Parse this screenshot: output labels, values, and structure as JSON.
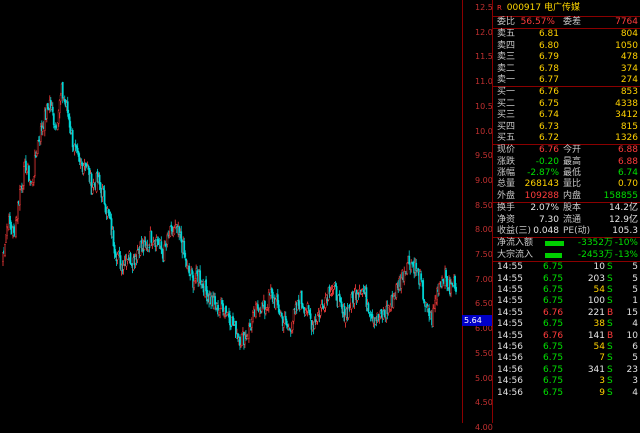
{
  "header": {
    "flag": "R",
    "code": "000917",
    "name": "电广传媒"
  },
  "axis": {
    "ticks": [
      "12.50",
      "12.00",
      "11.50",
      "11.00",
      "10.50",
      "10.00",
      "9.50",
      "9.00",
      "8.50",
      "8.00",
      "7.50",
      "7.00",
      "6.50",
      "6.00",
      "5.50",
      "5.00",
      "4.50",
      "4.00"
    ],
    "current": "5.64"
  },
  "order_book": {
    "ratio_label": "委比",
    "ratio": "56.57%",
    "diff_label": "委差",
    "diff": "7764",
    "asks": [
      {
        "label": "卖五",
        "price": "6.81",
        "vol": "804"
      },
      {
        "label": "卖四",
        "price": "6.80",
        "vol": "1050"
      },
      {
        "label": "卖三",
        "price": "6.79",
        "vol": "478"
      },
      {
        "label": "卖二",
        "price": "6.78",
        "vol": "374"
      },
      {
        "label": "卖一",
        "price": "6.77",
        "vol": "274"
      }
    ],
    "bids": [
      {
        "label": "买一",
        "price": "6.76",
        "vol": "853"
      },
      {
        "label": "买二",
        "price": "6.75",
        "vol": "4338"
      },
      {
        "label": "买三",
        "price": "6.74",
        "vol": "3412"
      },
      {
        "label": "买四",
        "price": "6.73",
        "vol": "815"
      },
      {
        "label": "买五",
        "price": "6.72",
        "vol": "1326"
      }
    ]
  },
  "quote": [
    {
      "l1": "现价",
      "v1": "6.76",
      "c1": "red",
      "l2": "今开",
      "v2": "6.88",
      "c2": "red"
    },
    {
      "l1": "涨跌",
      "v1": "-0.20",
      "c1": "grn",
      "l2": "最高",
      "v2": "6.88",
      "c2": "red"
    },
    {
      "l1": "涨幅",
      "v1": "-2.87%",
      "c1": "grn",
      "l2": "最低",
      "v2": "6.74",
      "c2": "grn"
    },
    {
      "l1": "总量",
      "v1": "268143",
      "c1": "yel",
      "l2": "量比",
      "v2": "0.70",
      "c2": "yel"
    },
    {
      "l1": "外盘",
      "v1": "109288",
      "c1": "red",
      "l2": "内盘",
      "v2": "158855",
      "c2": "grn"
    }
  ],
  "stats": [
    {
      "l1": "换手",
      "v1": "2.07%",
      "l2": "股本",
      "v2": "14.2亿"
    },
    {
      "l1": "净资",
      "v1": "7.30",
      "l2": "流通",
      "v2": "12.9亿"
    },
    {
      "l1": "收益(三)",
      "v1": "0.048",
      "l2": "PE(动)",
      "v2": "105.3"
    }
  ],
  "flows": [
    {
      "label": "净流入额",
      "amount": "-3352万",
      "pct": "-10%",
      "bar": 0.62
    },
    {
      "label": "大宗流入",
      "amount": "-2453万",
      "pct": "-13%",
      "bar": 0.58
    }
  ],
  "ticks": [
    {
      "t": "14:55",
      "p": "6.75",
      "v": "10",
      "s": "S",
      "n": "5",
      "pc": "grn",
      "vc": "wht"
    },
    {
      "t": "14:55",
      "p": "6.75",
      "v": "203",
      "s": "S",
      "n": "5",
      "pc": "grn",
      "vc": "wht"
    },
    {
      "t": "14:55",
      "p": "6.75",
      "v": "54",
      "s": "S",
      "n": "5",
      "pc": "grn",
      "vc": "yel"
    },
    {
      "t": "14:55",
      "p": "6.75",
      "v": "100",
      "s": "S",
      "n": "1",
      "pc": "grn",
      "vc": "wht"
    },
    {
      "t": "14:55",
      "p": "6.76",
      "v": "221",
      "s": "B",
      "n": "15",
      "pc": "red",
      "vc": "wht"
    },
    {
      "t": "14:55",
      "p": "6.75",
      "v": "38",
      "s": "S",
      "n": "4",
      "pc": "grn",
      "vc": "yel"
    },
    {
      "t": "14:55",
      "p": "6.76",
      "v": "141",
      "s": "B",
      "n": "10",
      "pc": "red",
      "vc": "wht"
    },
    {
      "t": "14:56",
      "p": "6.75",
      "v": "54",
      "s": "S",
      "n": "6",
      "pc": "grn",
      "vc": "yel"
    },
    {
      "t": "14:56",
      "p": "6.75",
      "v": "7",
      "s": "S",
      "n": "5",
      "pc": "grn",
      "vc": "yel"
    },
    {
      "t": "14:56",
      "p": "6.75",
      "v": "341",
      "s": "S",
      "n": "23",
      "pc": "grn",
      "vc": "wht"
    },
    {
      "t": "14:56",
      "p": "6.75",
      "v": "3",
      "s": "S",
      "n": "3",
      "pc": "grn",
      "vc": "yel"
    },
    {
      "t": "14:56",
      "p": "6.75",
      "v": "9",
      "s": "S",
      "n": "4",
      "pc": "grn",
      "vc": "yel"
    }
  ],
  "colors": {
    "up": "#ff3c3c",
    "down": "#00d8d8",
    "grid": "#8b0000",
    "blue_tag": "#0000c8"
  },
  "chart_data": {
    "type": "candlestick",
    "ylim": [
      4.0,
      12.5
    ],
    "close_path": [
      7.4,
      8.2,
      7.9,
      8.8,
      9.3,
      8.9,
      9.8,
      10.2,
      10.6,
      10.1,
      10.8,
      10.4,
      9.7,
      9.3,
      9.4,
      8.9,
      9.0,
      8.7,
      8.2,
      7.6,
      7.3,
      7.5,
      7.4,
      7.7,
      7.6,
      7.9,
      7.8,
      7.5,
      7.9,
      8.0,
      7.8,
      7.2,
      7.0,
      7.1,
      6.8,
      6.6,
      6.4,
      6.5,
      6.3,
      6.0,
      5.8,
      5.9,
      6.2,
      6.5,
      6.4,
      6.7,
      6.5,
      6.2,
      6.0,
      6.3,
      6.6,
      6.4,
      6.1,
      6.3,
      6.6,
      6.9,
      6.7,
      6.3,
      6.4,
      6.7,
      6.9,
      6.6,
      6.3,
      6.2,
      6.3,
      6.5,
      6.8,
      7.1,
      7.4,
      7.3,
      7.0,
      6.4,
      6.2,
      6.9,
      7.1,
      6.8,
      7.0
    ],
    "last_close": 6.76
  }
}
